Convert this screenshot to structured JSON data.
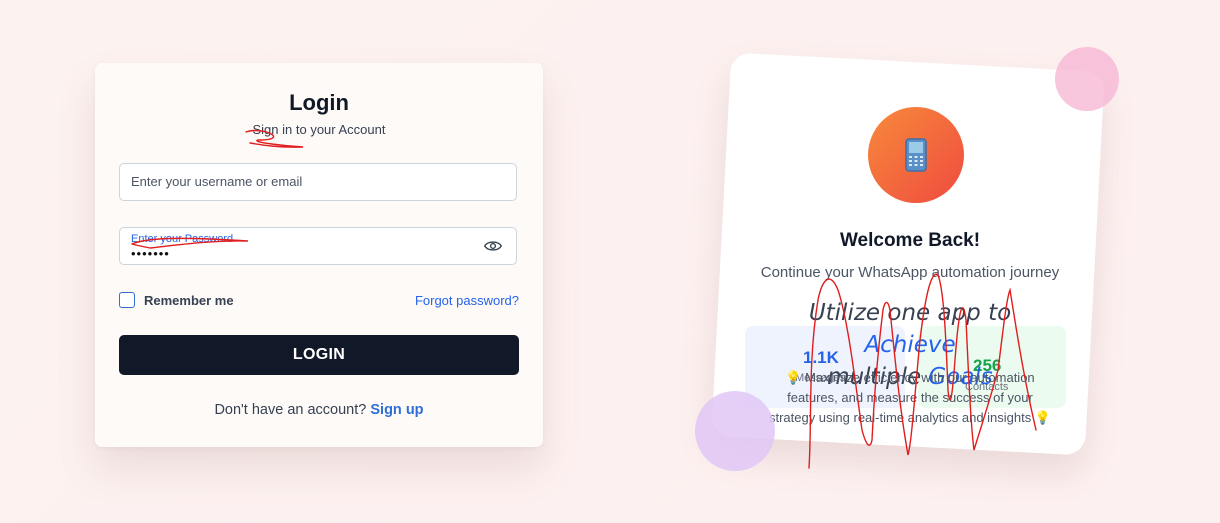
{
  "login": {
    "title": "Login",
    "subtitle": "Sign in to your Account",
    "username_placeholder": "Enter your username or email",
    "password_label": "Enter your Password",
    "password_value": "•••••••",
    "remember_label": "Remember me",
    "forgot_label": "Forgot password?",
    "login_button": "LOGIN",
    "signup_prompt": "Don't have an account?",
    "signup_link": "Sign up"
  },
  "welcome": {
    "title": "Welcome Back!",
    "subtitle": "Continue your WhatsApp automation journey",
    "stats": [
      {
        "value": "1.1K",
        "label": "Messages"
      },
      {
        "value": "256",
        "label": "Contacts"
      }
    ],
    "headline_part1": "Utilize one app to ",
    "headline_hl1": "Achieve",
    "headline_part2": "multiple ",
    "headline_hl2": "Goals",
    "description": "💡 Maximize efficiency with our automation features, and measure the success of your strategy using real-time analytics and insights 💡"
  },
  "colors": {
    "accent": "#2563eb",
    "button_bg": "#111827",
    "icon_gradient_start": "#f78a3b",
    "icon_gradient_end": "#ef4b3f",
    "scribble": "#e11d1d"
  }
}
